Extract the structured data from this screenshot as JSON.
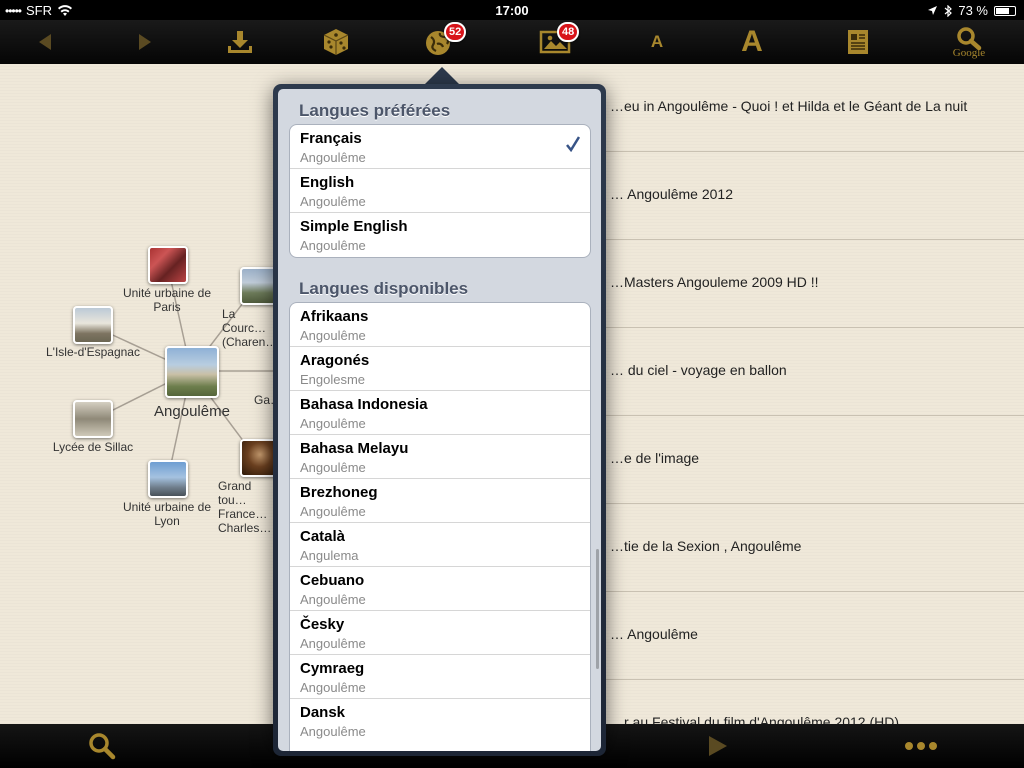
{
  "status": {
    "carrier": "SFR",
    "signal_dots": "•••••",
    "time": "17:00",
    "battery_text": "73 %",
    "battery_level": 0.73
  },
  "toolbar": {
    "globe_badge": "52",
    "images_badge": "48",
    "font_small": "A",
    "font_large": "A",
    "google_label": "Google"
  },
  "graph": {
    "center": "Angoulême",
    "nodes": [
      {
        "label": "Unité urbaine de Paris"
      },
      {
        "label": "La Courc… (Charen…"
      },
      {
        "label": "L'Isle-d'Espagnac"
      },
      {
        "label": "Ga…"
      },
      {
        "label": "Lycée de Sillac"
      },
      {
        "label": "Grand tou… France… Charles…"
      },
      {
        "label": "Unité urbaine de Lyon"
      }
    ]
  },
  "list": [
    "…eu in Angoulême - Quoi ! et Hilda et le Géant de La nuit",
    "… Angoulême 2012",
    "…Masters Angouleme 2009 HD !!",
    "… du ciel - voyage en ballon",
    "…e de l'image",
    "…tie de la Sexion , Angoulême",
    "… Angoulême",
    "…r au Festival du film d'Angoulême 2012 (HD)"
  ],
  "popover": {
    "preferred_title": "Langues préférées",
    "available_title": "Langues disponibles",
    "preferred": [
      {
        "name": "Français",
        "sub": "Angoulême",
        "checked": true
      },
      {
        "name": "English",
        "sub": "Angoulême",
        "checked": false
      },
      {
        "name": "Simple English",
        "sub": "Angoulême",
        "checked": false
      }
    ],
    "available": [
      {
        "name": "Afrikaans",
        "sub": "Angoulême"
      },
      {
        "name": "Aragonés",
        "sub": "Engolesme"
      },
      {
        "name": "Bahasa Indonesia",
        "sub": "Angoulême"
      },
      {
        "name": "Bahasa Melayu",
        "sub": "Angoulême"
      },
      {
        "name": "Brezhoneg",
        "sub": "Angoulême"
      },
      {
        "name": "Català",
        "sub": "Angulema"
      },
      {
        "name": "Cebuano",
        "sub": "Angoulême"
      },
      {
        "name": "Česky",
        "sub": "Angoulême"
      },
      {
        "name": "Cymraeg",
        "sub": "Angoulême"
      },
      {
        "name": "Dansk",
        "sub": "Angoulême"
      }
    ]
  },
  "colors": {
    "accent_gold": "#a8872d",
    "badge_red": "#d8141a",
    "check_blue": "#385487"
  }
}
